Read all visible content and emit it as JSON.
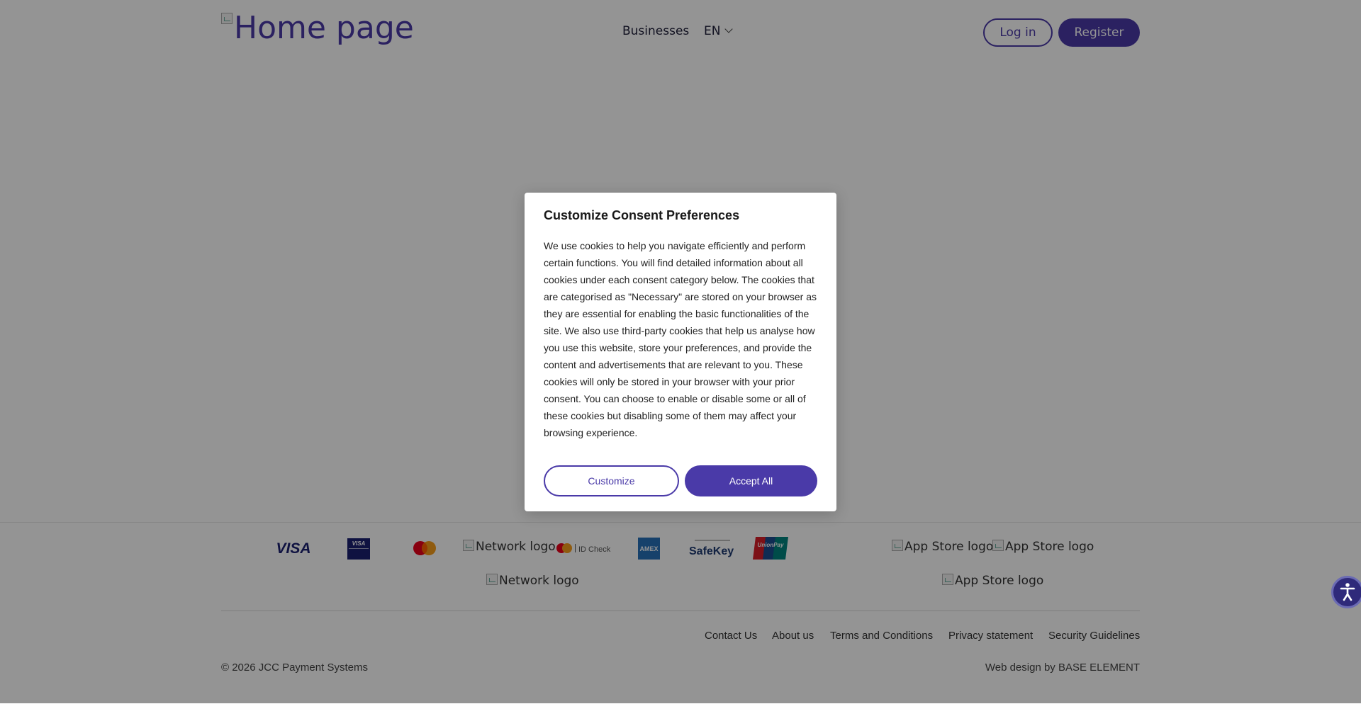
{
  "header": {
    "logo_alt": "Home page",
    "nav": {
      "businesses": "Businesses"
    },
    "language": "EN",
    "login": "Log in",
    "register": "Register"
  },
  "footer": {
    "payment_logos": {
      "visa": "VISA",
      "visa_secure": "VISA",
      "id_check": "ID Check",
      "amex": "AMEX",
      "safekey": "SafeKey",
      "unionpay": "UnionPay",
      "network_logo_alt_1": "Network logo",
      "network_logo_alt_2": "Network logo"
    },
    "app_store_alts": [
      "App Store logo",
      "App Store logo",
      "App Store logo"
    ],
    "links": [
      "Contact Us",
      "About us",
      "Terms and Conditions",
      "Privacy statement",
      "Security Guidelines"
    ],
    "copyright": "© 2026 JCC Payment Systems",
    "web_design": "Web design by BASE ELEMENT"
  },
  "consent_modal": {
    "title": "Customize Consent Preferences",
    "body": "We use cookies to help you navigate efficiently and perform certain functions. You will find detailed information about all cookies under each consent category below. The cookies that are categorised as \"Necessary\" are stored on your browser as they are essential for enabling the basic functionalities of the site. We also use third-party cookies that help us analyse how you use this website, store your preferences, and provide the content and advertisements that are relevant to you. These cookies will only be stored in your browser with your prior consent. You can choose to enable or disable some or all of these cookies but disabling some of them may affect your browsing experience.",
    "customize": "Customize",
    "accept_all": "Accept All"
  },
  "colors": {
    "brand": "#4a3aa8",
    "overlay": "rgba(0,0,0,0.42)"
  },
  "icons": {
    "accessibility": "accessibility-icon",
    "language_dropdown": "chevron-down-icon",
    "broken_image": "broken-image-icon"
  }
}
